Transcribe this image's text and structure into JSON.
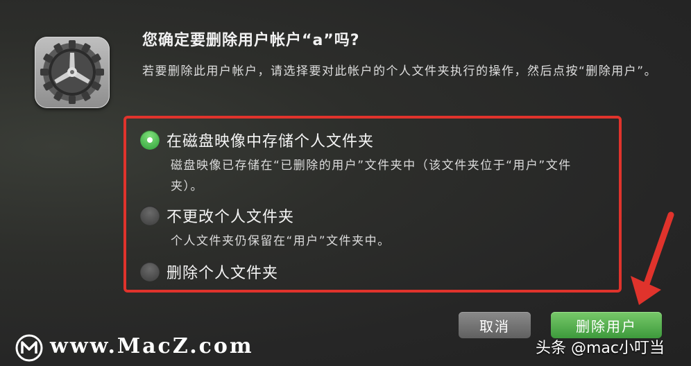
{
  "dialog": {
    "title": "您确定要删除用户帐户“a”吗?",
    "message": "若要删除此用户帐户，请选择要对此帐户的个人文件夹执行的操作，然后点按“删除用户”。",
    "app_icon": "system-preferences-gear-icon"
  },
  "options": [
    {
      "label": "在磁盘映像中存储个人文件夹",
      "description": "磁盘映像已存储在“已删除的用户”文件夹中（该文件夹位于“用户”文件夹）。",
      "selected": true
    },
    {
      "label": "不更改个人文件夹",
      "description": "个人文件夹仍保留在“用户”文件夹中。",
      "selected": false
    },
    {
      "label": "删除个人文件夹",
      "description": "",
      "selected": false
    }
  ],
  "buttons": {
    "cancel": "取消",
    "delete_user": "删除用户"
  },
  "watermark": {
    "site": "www.MacZ.com",
    "credit": "头条 @mac小叮当"
  },
  "colors": {
    "highlight_box": "#e0332c",
    "default_button": "#4fae47",
    "radio_selected": "#3fb54a"
  }
}
